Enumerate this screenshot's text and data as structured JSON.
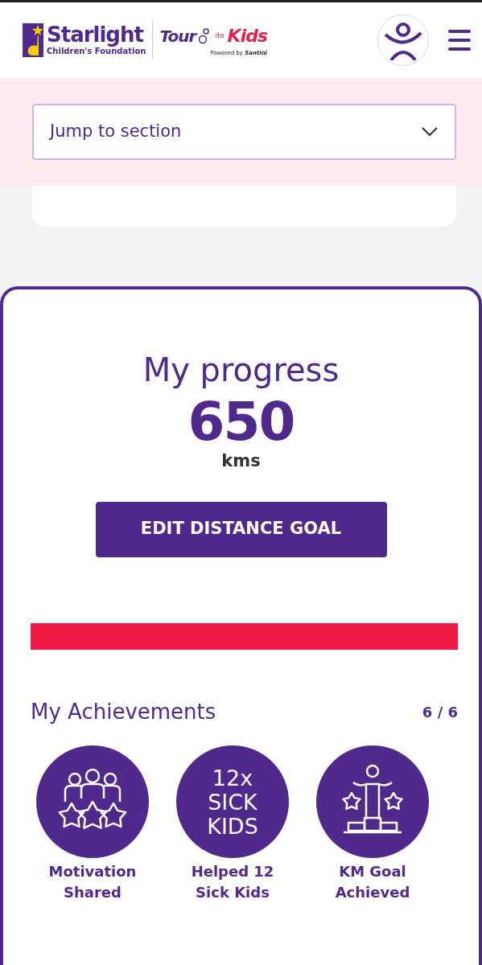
{
  "header": {
    "brand": {
      "name": "Starlight",
      "tagline": "Children's Foundation"
    },
    "event": {
      "word_1": "Tour",
      "word_2": "de",
      "word_3": "Kids",
      "sponsor_prefix": "Powered by",
      "sponsor": "Santini"
    }
  },
  "jump": {
    "value": "Jump to section"
  },
  "progress": {
    "title": "My progress",
    "distance": "650",
    "unit": "kms",
    "button": "EDIT DISTANCE GOAL",
    "level": 1
  },
  "achievements": {
    "title": "My Achievements",
    "count": "6 / 6",
    "items": [
      {
        "kind": "people-stars",
        "label": "Motivation Shared"
      },
      {
        "kind": "text",
        "lines": [
          "12x",
          "SICK",
          "KIDS"
        ],
        "label": "Helped 12 Sick Kids"
      },
      {
        "kind": "podium",
        "label": "KM Goal Achieved"
      }
    ]
  }
}
